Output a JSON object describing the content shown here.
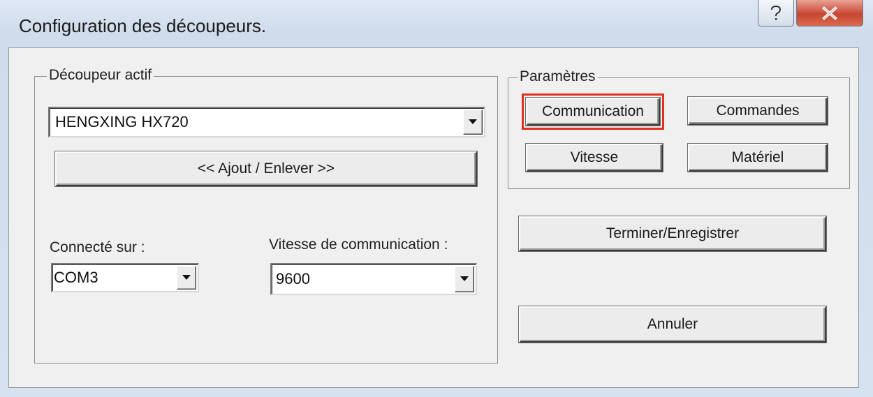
{
  "window": {
    "title": "Configuration des découpeurs.",
    "help_icon": "question-mark-icon",
    "close_icon": "close-x-icon"
  },
  "active_cutter_group": {
    "label": "Découpeur actif",
    "cutter_select": {
      "value": "HENGXING HX720"
    },
    "add_remove_button": "<< Ajout / Enlever >>",
    "port": {
      "label": "Connecté sur :",
      "value": "COM3"
    },
    "baud": {
      "label": "Vitesse de communication :",
      "value": "9600"
    }
  },
  "parameters_group": {
    "label": "Paramètres",
    "communication_button": "Communication",
    "commands_button": "Commandes",
    "speed_button": "Vitesse",
    "hardware_button": "Matériel"
  },
  "actions": {
    "finish_save_button": "Terminer/Enregistrer",
    "cancel_button": "Annuler"
  },
  "colors": {
    "highlight": "#e0301e",
    "close_button": "#c8452f"
  }
}
